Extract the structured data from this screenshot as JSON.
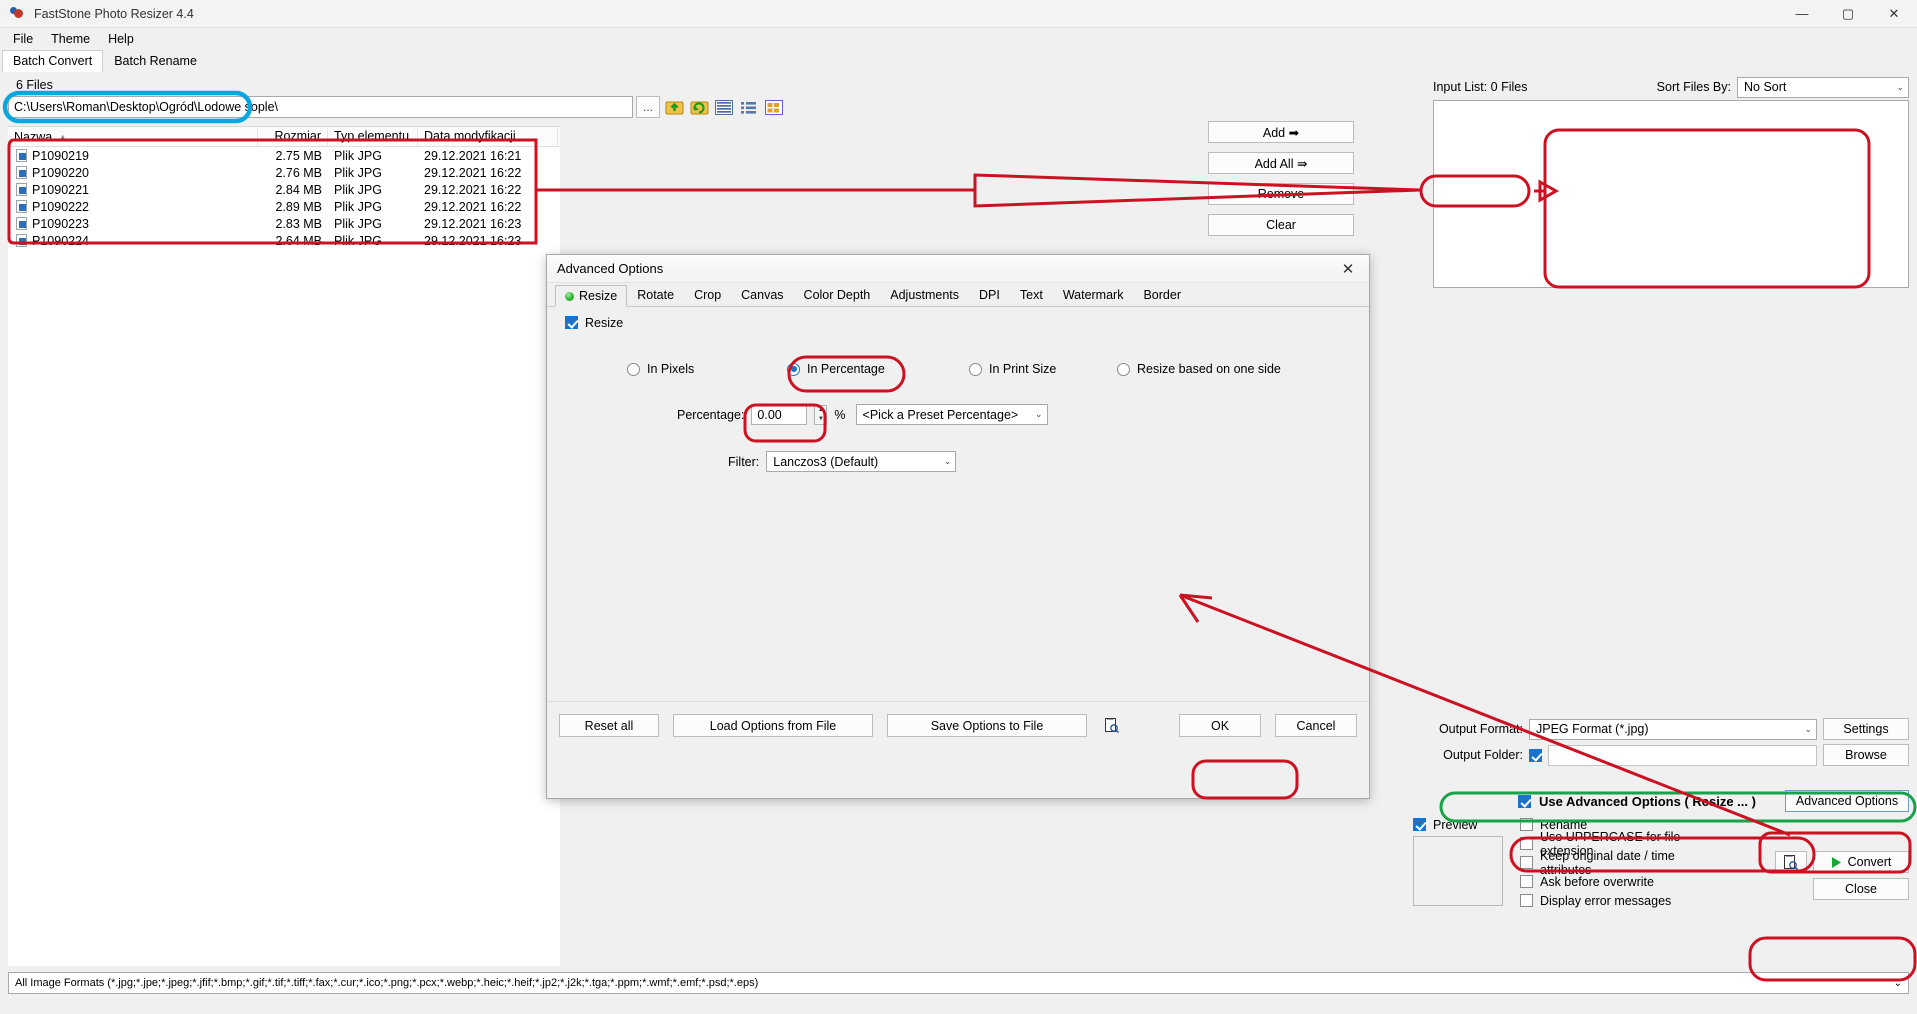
{
  "window": {
    "title": "FastStone Photo Resizer 4.4",
    "minimize": "—",
    "maximize": "▢",
    "close": "✕",
    "app_icon": "faststone-logo-icon"
  },
  "menu": {
    "items": [
      "File",
      "Theme",
      "Help"
    ]
  },
  "tabs": {
    "items": [
      "Batch Convert",
      "Batch Rename"
    ],
    "active": "Batch Convert"
  },
  "browser": {
    "file_count_label": "6 Files",
    "path_value": "C:\\Users\\Roman\\Desktop\\Ogród\\Lodowe sople\\",
    "dots_button": "...",
    "toolbar_icons": [
      "up-folder-icon",
      "refresh-folder-icon",
      "details-view-icon",
      "list-view-icon",
      "thumbnail-view-icon"
    ],
    "columns": [
      "Nazwa",
      "Rozmiar",
      "Typ elementu",
      "Data modyfikacji"
    ],
    "sort_indicator": "▲",
    "rows": [
      {
        "name": "P1090219",
        "size": "2.75 MB",
        "type": "Plik JPG",
        "date": "29.12.2021 16:21"
      },
      {
        "name": "P1090220",
        "size": "2.76 MB",
        "type": "Plik JPG",
        "date": "29.12.2021 16:22"
      },
      {
        "name": "P1090221",
        "size": "2.84 MB",
        "type": "Plik JPG",
        "date": "29.12.2021 16:22"
      },
      {
        "name": "P1090222",
        "size": "2.89 MB",
        "type": "Plik JPG",
        "date": "29.12.2021 16:22"
      },
      {
        "name": "P1090223",
        "size": "2.83 MB",
        "type": "Plik JPG",
        "date": "29.12.2021 16:23"
      },
      {
        "name": "P1090224",
        "size": "2.64 MB",
        "type": "Plik JPG",
        "date": "29.12.2021 16:23"
      }
    ]
  },
  "input_list": {
    "label": "Input List:  0 Files",
    "sort_label": "Sort Files By:",
    "sort_value": "No Sort",
    "buttons": [
      "Add  ➡",
      "Add All  ⇛",
      "Remove",
      "Clear"
    ]
  },
  "output": {
    "format_label": "Output Format:",
    "format_value": "JPEG Format (*.jpg)",
    "settings_button": "Settings",
    "folder_label": "Output Folder:",
    "folder_checked": true,
    "folder_value": "",
    "browse_button": "Browse"
  },
  "options": {
    "use_advanced_label": "Use Advanced Options ( Resize ... )",
    "use_advanced_checked": true,
    "advanced_button": "Advanced Options",
    "preview_label": "Preview",
    "preview_checked": true,
    "checkboxes": [
      {
        "label": "Rename",
        "checked": false
      },
      {
        "label": "Use UPPERCASE for file extension",
        "checked": false
      },
      {
        "label": "Keep original date / time attributes",
        "checked": false
      },
      {
        "label": "Ask before overwrite",
        "checked": false
      },
      {
        "label": "Display error messages",
        "checked": false
      }
    ],
    "convert_button": "Convert",
    "close_button": "Close",
    "preview_icon": "preview-magnifier-icon"
  },
  "dialog": {
    "title": "Advanced Options",
    "close_icon": "✕",
    "tabs": [
      "Resize",
      "Rotate",
      "Crop",
      "Canvas",
      "Color Depth",
      "Adjustments",
      "DPI",
      "Text",
      "Watermark",
      "Border"
    ],
    "active_tab": "Resize",
    "resize_checkbox_label": "Resize",
    "resize_checked": true,
    "modes": [
      {
        "label": "In Pixels",
        "selected": false
      },
      {
        "label": "In Percentage",
        "selected": true
      },
      {
        "label": "In Print Size",
        "selected": false
      },
      {
        "label": "Resize based on one side",
        "selected": false
      }
    ],
    "percentage_label": "Percentage:",
    "percentage_value": "0.00",
    "percent_sign": "%",
    "preset_value": "<Pick a Preset Percentage>",
    "filter_label": "Filter:",
    "filter_value": "Lanczos3 (Default)",
    "footer_buttons": [
      "Reset all",
      "Load Options from File",
      "Save Options to File"
    ],
    "footer_icon": "preview-magnifier-icon",
    "ok_button": "OK",
    "cancel_button": "Cancel"
  },
  "statusbar": {
    "formats": "All Image Formats (*.jpg;*.jpe;*.jpeg;*.jfif;*.bmp;*.gif;*.tif;*.tiff;*.fax;*.cur;*.ico;*.png;*.pcx;*.webp;*.heic;*.heif;*.jp2;*.j2k;*.tga;*.ppm;*.wmf;*.emf;*.psd;*.eps)",
    "arrow": "⌄"
  },
  "annotations": {
    "red": "#cc1122",
    "blue": "#09a7e0",
    "green": "#18a24a"
  }
}
